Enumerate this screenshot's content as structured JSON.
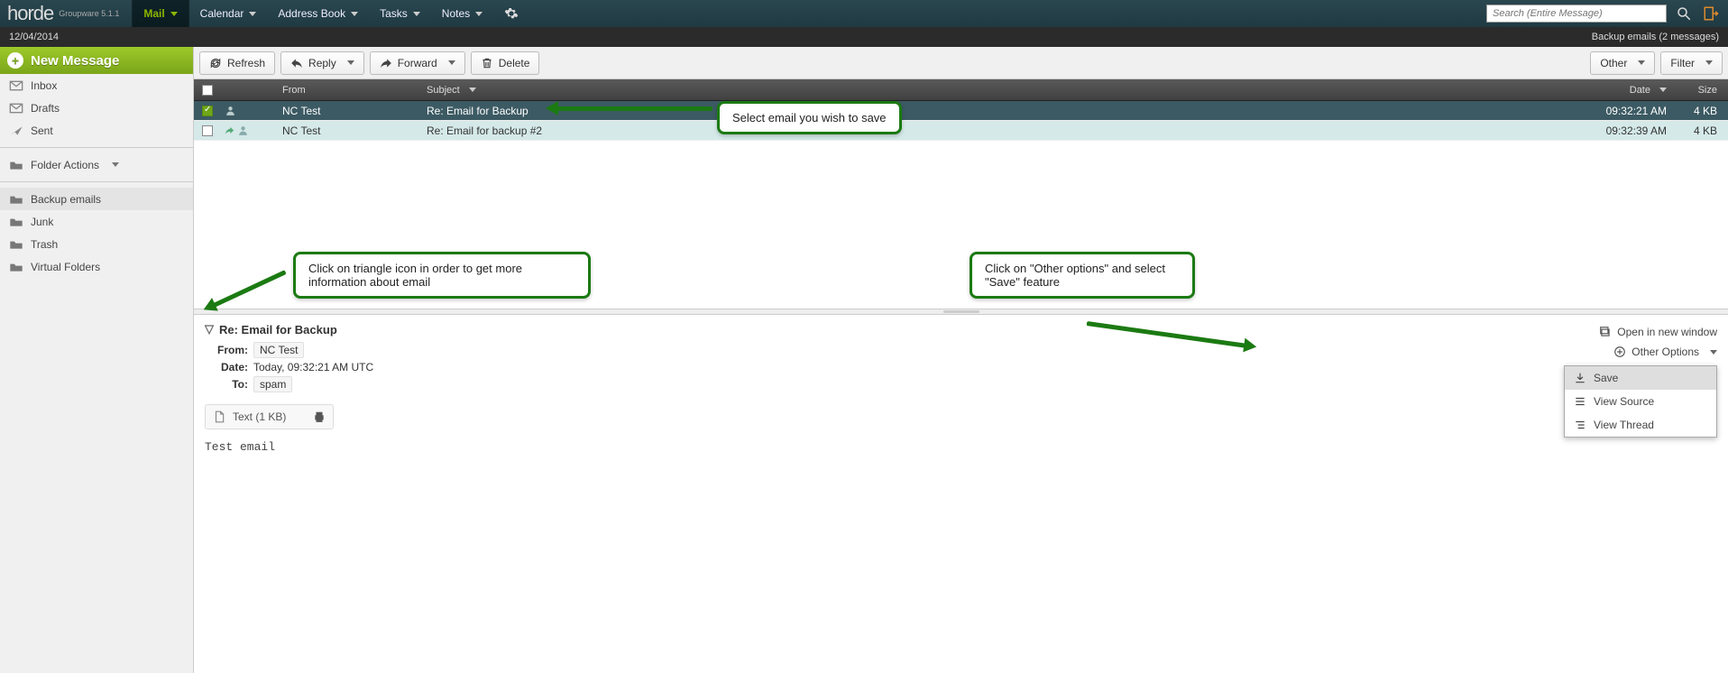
{
  "app": {
    "name": "horde",
    "suite": "Groupware 5.1.1"
  },
  "nav": {
    "items": [
      "Mail",
      "Calendar",
      "Address Book",
      "Tasks",
      "Notes"
    ],
    "active_index": 0,
    "search_placeholder": "Search (Entire Message)"
  },
  "status": {
    "date": "12/04/2014",
    "folder_info": "Backup emails (2 messages)"
  },
  "sidebar": {
    "new_message": "New Message",
    "mailboxes": [
      "Inbox",
      "Drafts",
      "Sent"
    ],
    "folder_actions": "Folder Actions",
    "folders": [
      "Backup emails",
      "Junk",
      "Trash",
      "Virtual Folders"
    ],
    "selected_folder_index": 0
  },
  "toolbar": {
    "refresh": "Refresh",
    "reply": "Reply",
    "forward": "Forward",
    "delete": "Delete",
    "other": "Other",
    "filter": "Filter"
  },
  "columns": {
    "from": "From",
    "subject": "Subject",
    "date": "Date",
    "size": "Size"
  },
  "messages": [
    {
      "from": "NC Test",
      "subject": "Re: Email for Backup",
      "date": "09:32:21 AM",
      "size": "4 KB",
      "selected": true,
      "replied": false
    },
    {
      "from": "NC Test",
      "subject": "Re: Email for backup #2",
      "date": "09:32:39 AM",
      "size": "4 KB",
      "selected": false,
      "replied": true
    }
  ],
  "preview": {
    "subject": "Re: Email for Backup",
    "from_label": "From:",
    "from": "NC Test",
    "date_label": "Date:",
    "date": "Today, 09:32:21 AM UTC",
    "to_label": "To:",
    "to": "spam",
    "attachment": "Text (1 KB)",
    "body": "Test email",
    "open_window": "Open in new window",
    "other_options": "Other Options"
  },
  "options_menu": {
    "save": "Save",
    "view_source": "View Source",
    "view_thread": "View Thread"
  },
  "callouts": {
    "c1": "Select email you wish to save",
    "c2": "Click on triangle icon in order to get more information about email",
    "c3": "Click on \"Other options\" and select \"Save\" feature"
  }
}
